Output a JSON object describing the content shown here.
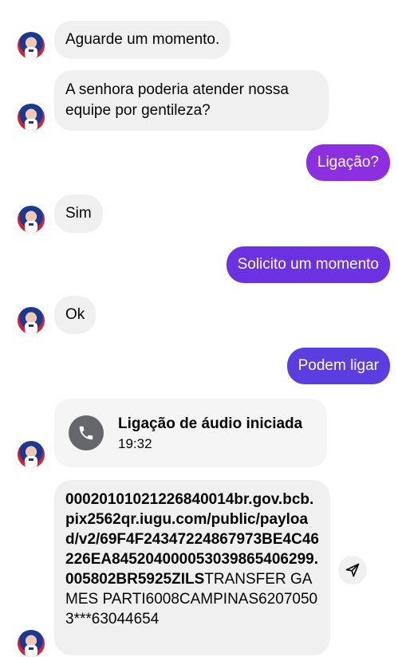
{
  "colors": {
    "incoming_bubble": "#f0f0f0",
    "outgoing_top": "#8e2de2",
    "outgoing_mid": "#6a2fe0",
    "outgoing_bottom": "#5b3be0",
    "call_icon_bg": "#65676b"
  },
  "messages": [
    {
      "side": "in",
      "text": "Aguarde um momento."
    },
    {
      "side": "in",
      "text": "A senhora poderia atender nossa equipe por gentileza?"
    },
    {
      "side": "out",
      "text": "Ligação?"
    },
    {
      "side": "in",
      "text": "Sim"
    },
    {
      "side": "out",
      "text": "Solicito um momento"
    },
    {
      "side": "in",
      "text": "Ok"
    },
    {
      "side": "out",
      "text": "Podem ligar"
    }
  ],
  "call": {
    "icon": "phone-icon",
    "title": "Ligação de áudio iniciada",
    "time": "19:32"
  },
  "pix_message": {
    "bold_text": "00020101021226840014br.gov.bcb.pix2562qr.iugu.com/public/payload/v2/69F4F24347224867973BE4C46226EA845204000053039865406299.005802BR5925ZILS",
    "normal_text": "TRANSFER GAMES PARTI6008CAMPINAS62070503***63044654"
  },
  "share_icon": "send-icon"
}
